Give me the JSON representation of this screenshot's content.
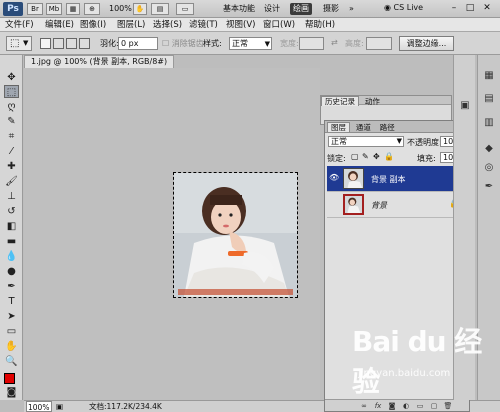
{
  "app": {
    "logo": "Ps",
    "zoom": "100%",
    "workspaces": [
      "基本功能",
      "设计",
      "绘画",
      "摄影"
    ],
    "active_workspace": "绘画",
    "more": "»",
    "cs_live": "CS Live"
  },
  "menu": [
    "文件(F)",
    "编辑(E)",
    "图像(I)",
    "图层(L)",
    "选择(S)",
    "滤镜(T)",
    "视图(V)",
    "窗口(W)",
    "帮助(H)"
  ],
  "options": {
    "feather_label": "羽化:",
    "feather_value": "0 px",
    "antialias_label": "消除锯齿",
    "style_label": "样式:",
    "style_value": "正常",
    "width_label": "宽度:",
    "height_label": "高度:",
    "refine_edge": "调整边缘..."
  },
  "document": {
    "tab_title": "1.jpg @ 100% (背景 副本, RGB/8#) *",
    "status_zoom": "100%",
    "status_info": "文档:117.2K/234.4K"
  },
  "history_panel": {
    "tabs": [
      "历史记录",
      "动作"
    ]
  },
  "layers_panel": {
    "tabs": [
      "图层",
      "通道",
      "路径"
    ],
    "blend_mode": "正常",
    "opacity_label": "不透明度:",
    "opacity_value": "100%",
    "lock_label": "锁定:",
    "fill_label": "填充:",
    "fill_value": "100%",
    "layers": [
      {
        "name": "背景 副本",
        "selected": true,
        "visible": true
      },
      {
        "name": "背景",
        "selected": false,
        "visible": false
      }
    ]
  },
  "watermark": {
    "brand": "Bai du 经验",
    "url": "jingyan.baidu.com"
  },
  "colors": {
    "foreground": "#e00000",
    "background": "#ffffff",
    "selected_layer": "#1f3a93"
  }
}
